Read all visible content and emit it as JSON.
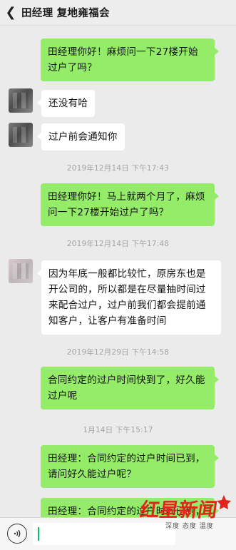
{
  "header": {
    "back_icon": "chevron-left-icon",
    "title": "田经理  复地雍福会"
  },
  "messages": [
    {
      "side": "out",
      "text": "田经理你好！麻烦问一下27楼开始过户了吗？"
    },
    {
      "side": "in",
      "text": "还没有哈"
    },
    {
      "side": "in",
      "text": "过户前会通知你"
    },
    {
      "type": "timestamp",
      "text": "2019年12月14日 下午17:43"
    },
    {
      "side": "out",
      "text": "田经理你好！马上就两个月了，麻烦问一下27楼开始过户了吗？"
    },
    {
      "type": "timestamp",
      "text": "2019年12月14日 下午17:48"
    },
    {
      "side": "in",
      "text": "因为年底一般都比较忙，原房东也是开公司的，所以都是在尽量抽时间过来配合过户，过户前我们都会提前通知客户，让客户有准备时间"
    },
    {
      "type": "timestamp",
      "text": "2019年12月29日 下午14:58"
    },
    {
      "side": "out",
      "text": "合同约定的过户时间快到了，好久能过户呢"
    },
    {
      "type": "timestamp",
      "text": "1月14日 下午15:17"
    },
    {
      "side": "out",
      "text": "田经理：合同约定的过户时间已到，请问好久能过户呢？"
    },
    {
      "side": "out",
      "text": "田经理：合同约定的过户时间已到，"
    }
  ],
  "input": {
    "voice_icon": "voice-icon",
    "value": ""
  },
  "watermark": {
    "logo": "红星新闻",
    "tagline": "深度 态度 温度"
  },
  "colors": {
    "outgoing_bubble": "#95ec69",
    "incoming_bubble": "#ffffff",
    "background": "#ebebeb"
  }
}
